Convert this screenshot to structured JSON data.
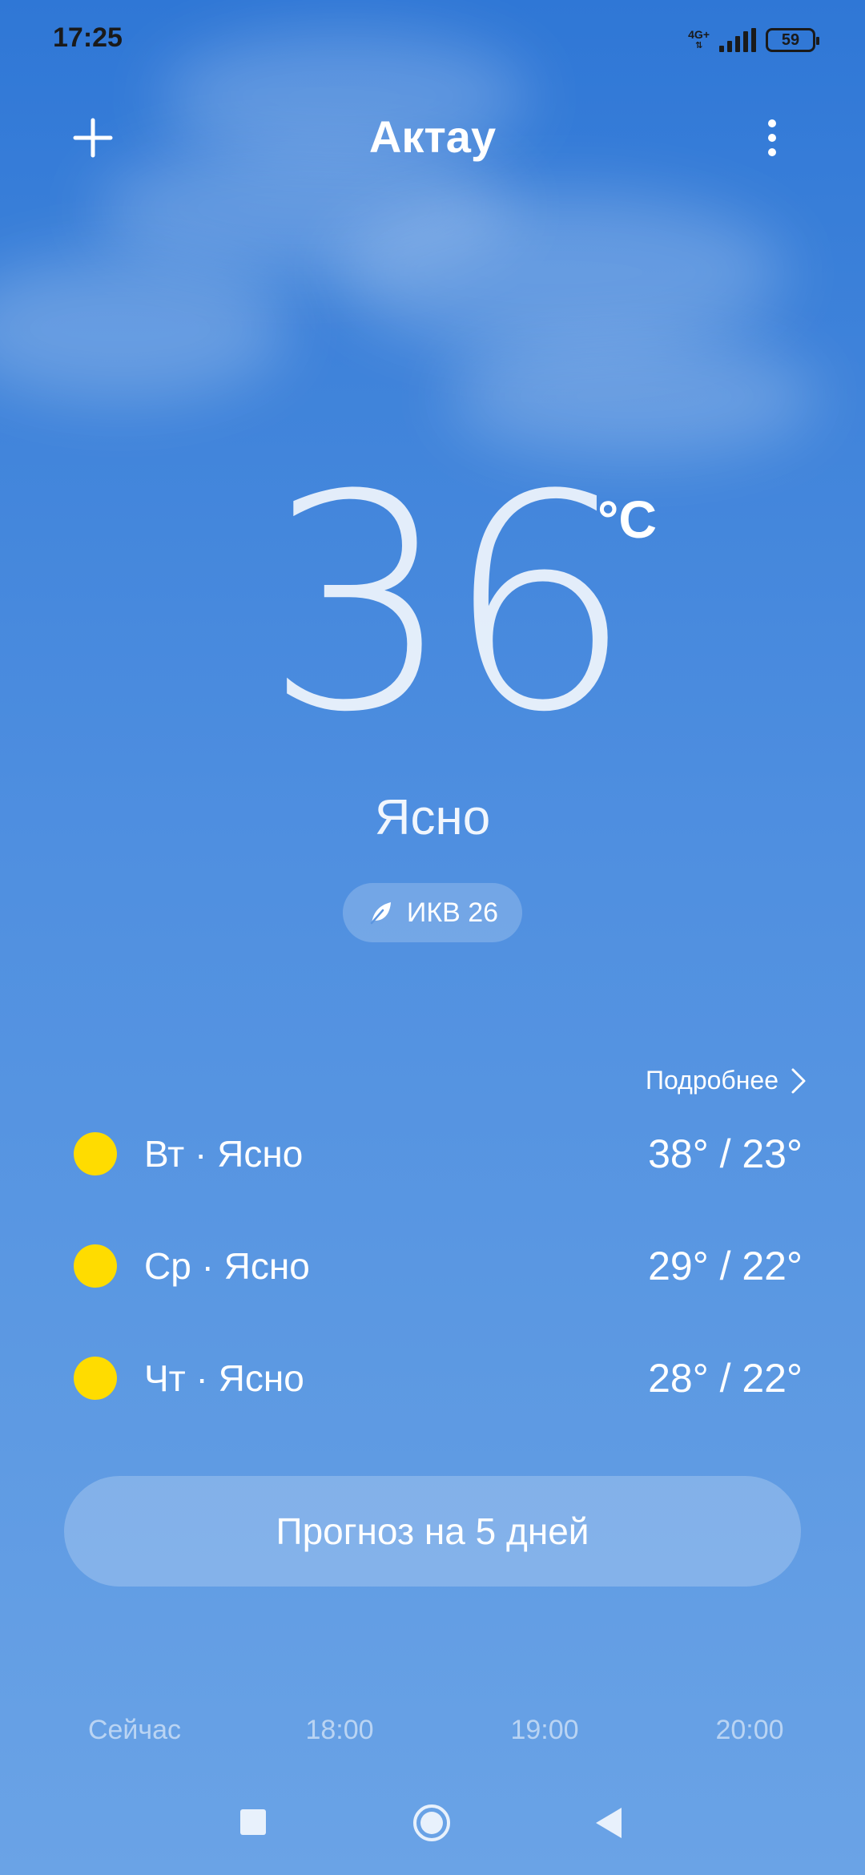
{
  "status_bar": {
    "time": "17:25",
    "network": "4G+",
    "battery": "59"
  },
  "header": {
    "city": "Актау",
    "add_icon": "plus-icon",
    "menu_icon": "more-vertical-icon"
  },
  "current": {
    "temperature": "36",
    "unit": "°C",
    "condition": "Ясно",
    "aqi_label": "ИКВ 26",
    "aqi_icon": "leaf-icon"
  },
  "forecast": {
    "more_label": "Подробнее",
    "days": [
      {
        "label": "Вт · Ясно",
        "temps": "38° / 23°",
        "icon": "sun-icon"
      },
      {
        "label": "Ср · Ясно",
        "temps": "29° / 22°",
        "icon": "sun-icon"
      },
      {
        "label": "Чт · Ясно",
        "temps": "28° / 22°",
        "icon": "sun-icon"
      }
    ],
    "button_label": "Прогноз на 5 дней"
  },
  "hourly": [
    "Сейчас",
    "18:00",
    "19:00",
    "20:00"
  ],
  "colors": {
    "background_top": "#2f77d6",
    "background_bottom": "#6aa3e6",
    "sun": "#ffdc00"
  }
}
